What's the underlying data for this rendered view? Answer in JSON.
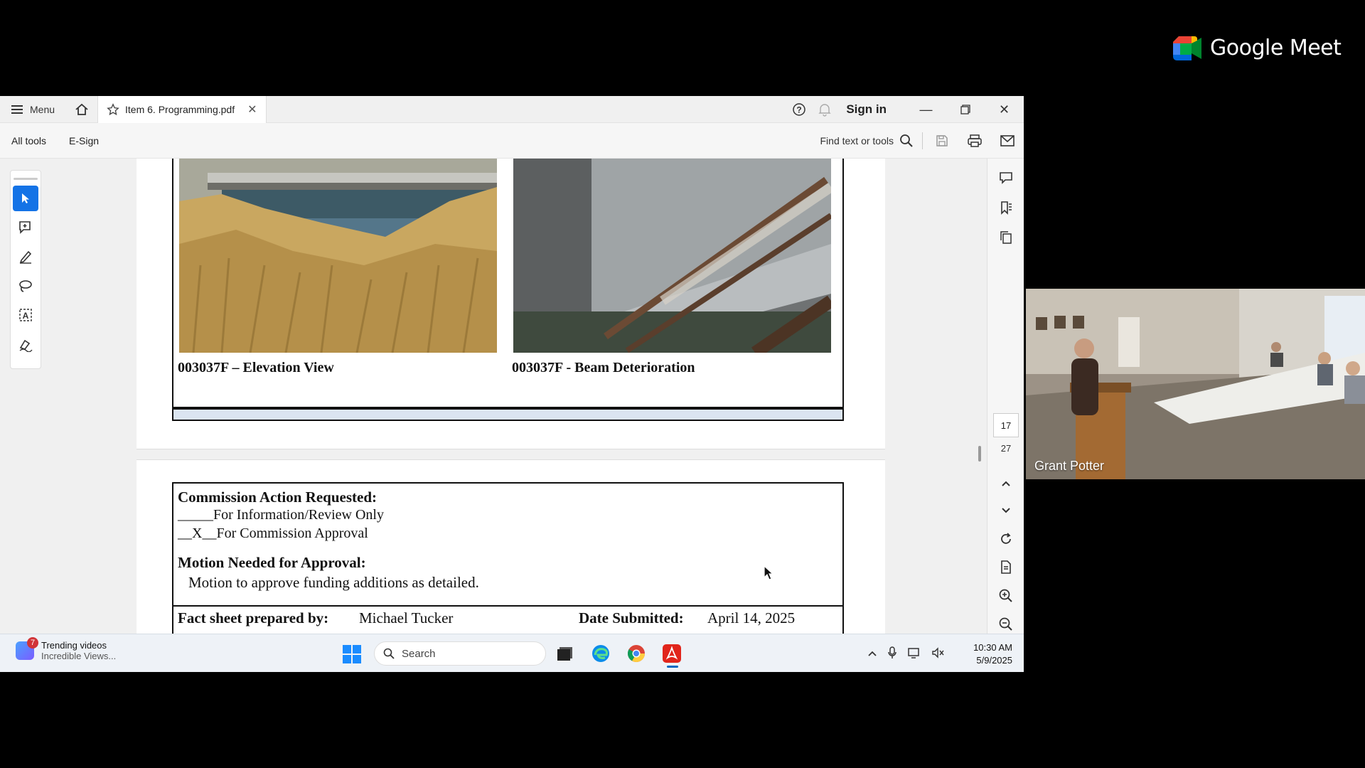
{
  "meet": {
    "brand": "Google Meet"
  },
  "participant": {
    "name": "Grant Potter"
  },
  "window": {
    "menu_label": "Menu",
    "tab_title": "Item 6. Programming.pdf",
    "sign_in": "Sign in"
  },
  "toolbar": {
    "all_tools": "All tools",
    "esign": "E-Sign",
    "find": "Find text or tools"
  },
  "document": {
    "photo_captions": [
      "003037F – Elevation View",
      "003037F - Beam Deterioration"
    ],
    "action_heading": "Commission Action Requested:",
    "option_info": "_____For Information/Review Only",
    "option_approval": "__X__For Commission Approval",
    "motion_heading": "Motion Needed for Approval:",
    "motion_text": "Motion to approve funding additions as detailed.",
    "prepared_label": "Fact sheet prepared by:",
    "prepared_value": "Michael Tucker",
    "date_label": "Date Submitted:",
    "date_value": "April 14, 2025"
  },
  "page_nav": {
    "current": "17",
    "total": "27"
  },
  "taskbar": {
    "trending_title": "Trending videos",
    "trending_sub": "Incredible Views...",
    "trending_badge": "7",
    "search_placeholder": "Search",
    "time": "10:30 AM",
    "date": "5/9/2025"
  },
  "colors": {
    "accent": "#1473e6",
    "acrobat_red": "#e1251b",
    "document_blue_bar": "#dbe5f1"
  }
}
